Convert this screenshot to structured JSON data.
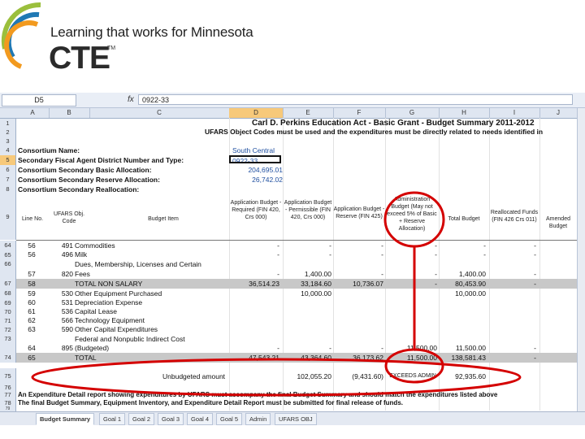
{
  "logo": {
    "tagline": "Learning that works for Minnesota",
    "brand": "CTE",
    "trademark": "TM"
  },
  "formula_bar": {
    "name_box": "D5",
    "fx": "fx",
    "value": "0922-33"
  },
  "columns": [
    "A",
    "B",
    "C",
    "D",
    "E",
    "F",
    "G",
    "H",
    "I",
    "J"
  ],
  "rows": [
    {
      "num": "1",
      "cells": {
        "title": "Carl D. Perkins Education Act - Basic Grant - Budget Summary 2011-2012"
      }
    },
    {
      "num": "2",
      "cells": {
        "subtitle": "UFARS Object Codes must be used and the expenditures must be directly related to needs identified in"
      }
    },
    {
      "num": "3",
      "cells": {}
    },
    {
      "num": "4",
      "cells": {
        "label": "Consortium Name:",
        "value": "South Central"
      }
    },
    {
      "num": "5",
      "cells": {
        "label": "Secondary Fiscal Agent District Number and Type:",
        "value": "0922-33"
      }
    },
    {
      "num": "6",
      "cells": {
        "label": "Consortium Secondary Basic Allocation:",
        "value": "204,695.01"
      }
    },
    {
      "num": "7",
      "cells": {
        "label": "Consortium Secondary Reserve Allocation:",
        "value": "26,742.02"
      }
    },
    {
      "num": "8",
      "cells": {
        "label": "Consortium Secondary Reallocation:"
      }
    }
  ],
  "header_row": {
    "num": "9",
    "line_no": "Line No.",
    "ufars": "UFARS Obj. Code",
    "budget_item": "Budget Item",
    "d": "Application Budget - Required (FIN 420, Crs 000)",
    "e": "Application Budget - Permissible (FIN 420, Crs 000)",
    "f": "Application Budget - Reserve (FIN 425)",
    "g": "Administration Budget (May not exceed 5% of Basic + Reserve Allocation)",
    "h": "Total Budget",
    "i": "Reallocated Funds (FIN 426 Crs 011)",
    "j": "Amended Budget"
  },
  "data_rows": [
    {
      "num": "64",
      "a": "56",
      "b": "491",
      "item": "Commodities",
      "d": "-",
      "e": "-",
      "f": "-",
      "g": "-",
      "h": "-",
      "i": "-",
      "gray": false
    },
    {
      "num": "65",
      "a": "56",
      "b": "496",
      "item": "Milk",
      "d": "-",
      "e": "-",
      "f": "-",
      "g": "-",
      "h": "-",
      "i": "-",
      "gray": false
    },
    {
      "num": "66",
      "a": "",
      "b": "",
      "item": "Dues, Membership, Licenses and Certain",
      "d": "",
      "e": "",
      "f": "",
      "g": "",
      "h": "",
      "i": "",
      "gray": false
    },
    {
      "num": "",
      "a": "57",
      "b": "820",
      "item": "Fees",
      "d": "-",
      "e": "1,400.00",
      "f": "-",
      "g": "-",
      "h": "1,400.00",
      "i": "-",
      "gray": false
    },
    {
      "num": "67",
      "a": "58",
      "b": "",
      "item": "TOTAL NON SALARY",
      "d": "36,514.23",
      "e": "33,184.60",
      "f": "10,736.07",
      "g": "-",
      "h": "80,453.90",
      "i": "-",
      "gray": true
    },
    {
      "num": "68",
      "a": "59",
      "b": "530",
      "item": "Other Equipment Purchased",
      "d": "",
      "e": "10,000.00",
      "f": "",
      "g": "",
      "h": "10,000.00",
      "i": "",
      "gray": false
    },
    {
      "num": "69",
      "a": "60",
      "b": "531",
      "item": "Depreciation Expense",
      "d": "",
      "e": "",
      "f": "",
      "g": "",
      "h": "",
      "i": "",
      "gray": false
    },
    {
      "num": "70",
      "a": "61",
      "b": "536",
      "item": "Capital Lease",
      "d": "",
      "e": "",
      "f": "",
      "g": "",
      "h": "",
      "i": "",
      "gray": false
    },
    {
      "num": "71",
      "a": "62",
      "b": "566",
      "item": "Technology Equipment",
      "d": "",
      "e": "",
      "f": "",
      "g": "",
      "h": "",
      "i": "",
      "gray": false
    },
    {
      "num": "72",
      "a": "63",
      "b": "590",
      "item": "Other Capital Expenditures",
      "d": "",
      "e": "",
      "f": "",
      "g": "",
      "h": "",
      "i": "",
      "gray": false
    },
    {
      "num": "73",
      "a": "",
      "b": "",
      "item": "Federal and Nonpublic Indirect Cost",
      "d": "",
      "e": "",
      "f": "",
      "g": "",
      "h": "",
      "i": "",
      "gray": false
    },
    {
      "num": "",
      "a": "64",
      "b": "895",
      "item": "(Budgeted)",
      "d": "-",
      "e": "-",
      "f": "-",
      "g": "11,500.00",
      "h": "11,500.00",
      "i": "-",
      "gray": false
    },
    {
      "num": "74",
      "a": "65",
      "b": "",
      "item": "TOTAL",
      "d": "47,543.21",
      "e": "43,364.60",
      "f": "36,173.62",
      "g": "11,500.00",
      "h": "138,581.43",
      "i": "-",
      "gray": true
    }
  ],
  "unbudgeted_row": {
    "num": "75",
    "label": "Unbudgeted amount",
    "e": "102,055.20",
    "f": "(9,431.60)",
    "g": "EXCEEDS ADMIN",
    "h": "92,935.60"
  },
  "note_rows": [
    {
      "num": "76",
      "text": ""
    },
    {
      "num": "77",
      "text": "An Expenditure Detail report showing expenditures by UFARS must accompany the final Budget Summary and should match the expenditures listed above"
    },
    {
      "num": "78",
      "text": "The final Budget Summary, Equipment Inventory, and Expenditure Detail Report must be submitted for final release of funds."
    },
    {
      "num": "79",
      "text": ""
    }
  ],
  "sheet_tabs": [
    "Budget Summary",
    "Goal 1",
    "Goal 2",
    "Goal 3",
    "Goal 4",
    "Goal 5",
    "Admin",
    "UFARS OBJ"
  ],
  "colors": {
    "annotation": "#d40000",
    "selected": "#f7c97a",
    "header_bg": "#dfe6f1",
    "gray_row": "#c8c8c8",
    "blue_text": "#1f4fa0"
  }
}
